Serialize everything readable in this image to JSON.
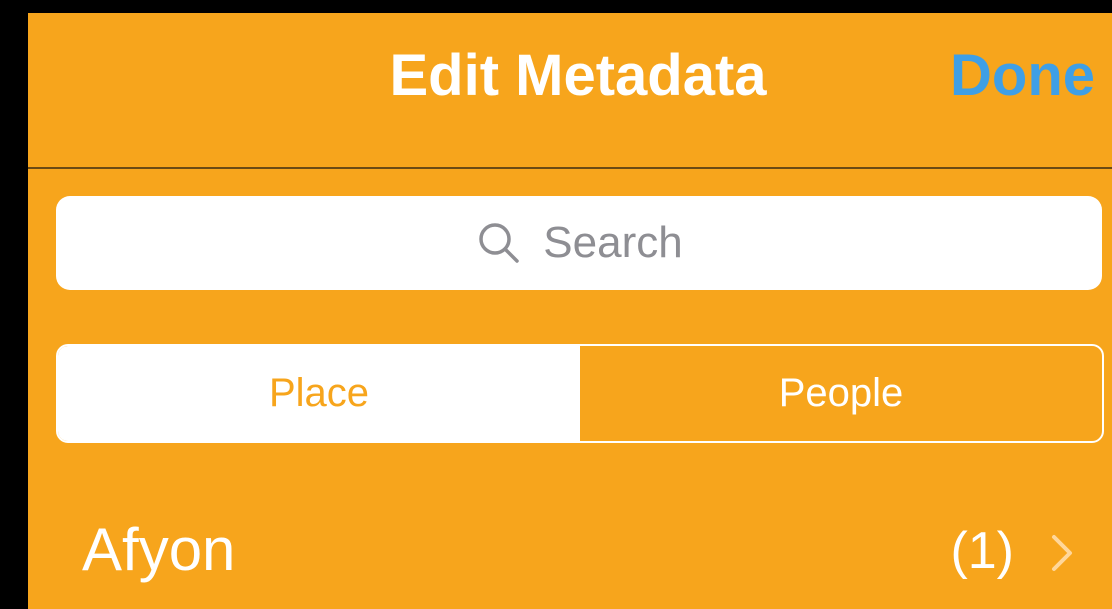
{
  "navbar": {
    "title": "Edit Metadata",
    "done_label": "Done"
  },
  "search": {
    "placeholder": "Search",
    "icon": "search-icon"
  },
  "segmented_control": {
    "segments": [
      {
        "label": "Place",
        "selected": true
      },
      {
        "label": "People",
        "selected": false
      }
    ]
  },
  "list": {
    "items": [
      {
        "title": "Afyon",
        "count": "(1)",
        "icon": "chevron-right-icon"
      }
    ]
  },
  "colors": {
    "background": "#f7a51c",
    "accent": "#3f9fe6",
    "text": "#ffffff",
    "placeholder": "#8e8e93"
  }
}
